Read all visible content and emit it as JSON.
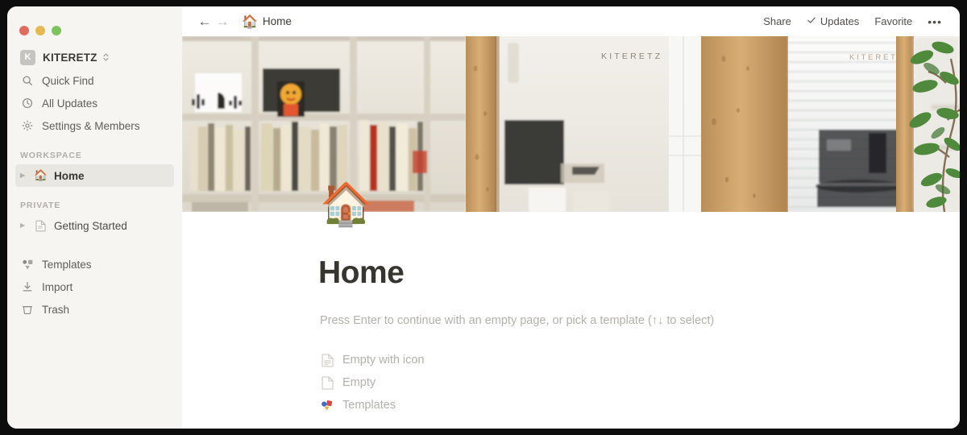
{
  "window": {
    "traffic_lights": [
      "close",
      "minimize",
      "zoom"
    ],
    "colors": {
      "sidebar_bg": "#f6f5f2",
      "content_bg": "#ffffff",
      "selected_row": "#e9e7e2",
      "title_color": "#37352f",
      "muted_text": "#b3b1ab"
    }
  },
  "sidebar": {
    "workspace": {
      "badge": "K",
      "name": "KITERETZ",
      "switcher_icon": "chevron-up-down-icon"
    },
    "nav": [
      {
        "label": "Quick Find",
        "icon": "search-icon"
      },
      {
        "label": "All Updates",
        "icon": "clock-icon"
      },
      {
        "label": "Settings & Members",
        "icon": "gear-icon"
      }
    ],
    "sections": [
      {
        "label": "WORKSPACE",
        "items": [
          {
            "label": "Home",
            "emoji": "🏠",
            "selected": true,
            "disclosure": "▶"
          }
        ]
      },
      {
        "label": "PRIVATE",
        "items": [
          {
            "label": "Getting Started",
            "emoji": "page-icon",
            "selected": false,
            "disclosure": "▶"
          }
        ]
      }
    ],
    "bottom": [
      {
        "label": "Templates",
        "icon": "templates-icon"
      },
      {
        "label": "Import",
        "icon": "import-icon"
      },
      {
        "label": "Trash",
        "icon": "trash-icon"
      }
    ]
  },
  "topbar": {
    "back_icon": "arrow-left-icon",
    "forward_icon": "arrow-right-icon",
    "breadcrumb": {
      "emoji": "🏠",
      "label": "Home"
    },
    "actions": [
      {
        "label": "Share",
        "icon": ""
      },
      {
        "label": "Updates",
        "icon": "check-icon"
      },
      {
        "label": "Favorite",
        "icon": ""
      }
    ],
    "more_label": "•••"
  },
  "cover": {
    "alt": "Office interior with bookshelf, wooden pillars, window blinds and a plant",
    "wall_text_left": "KITERETZ",
    "wall_text_right": "KITERETZ"
  },
  "page": {
    "icon": "🏠",
    "title": "Home",
    "hint": "Press Enter to continue with an empty page, or pick a template (↑↓ to select)",
    "templates": [
      {
        "label": "Empty with icon",
        "icon": "document-lines-icon"
      },
      {
        "label": "Empty",
        "icon": "document-blank-icon"
      },
      {
        "label": "Templates",
        "icon": "templates-color-icon"
      }
    ]
  }
}
